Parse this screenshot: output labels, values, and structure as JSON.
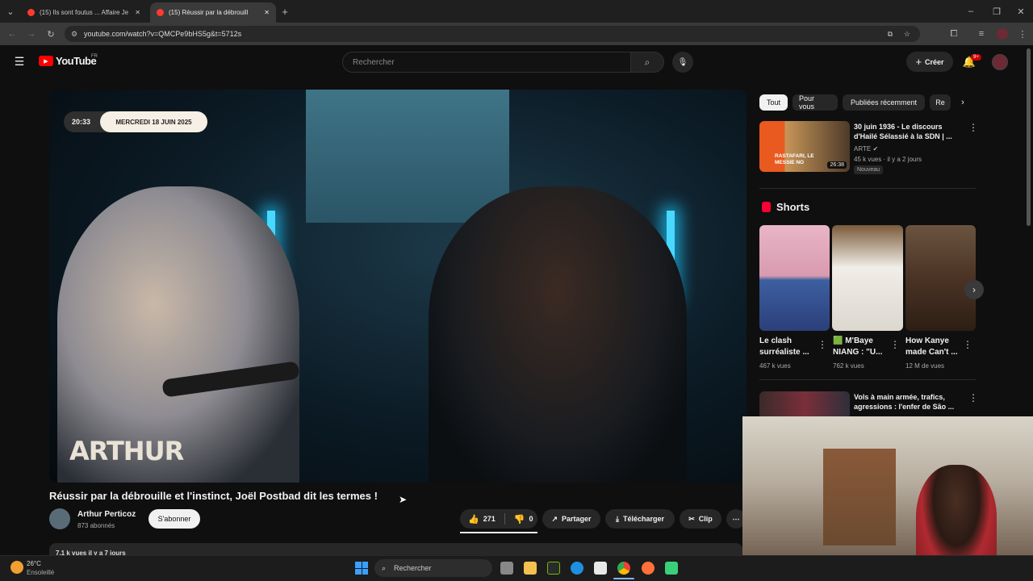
{
  "browser": {
    "tabs": [
      {
        "title": "(15) Ils sont foutus ... Affaire Je"
      },
      {
        "title": "(15) Réussir par la débrouill"
      }
    ],
    "url": "youtube.com/watch?v=QMCPe9bHS5g&t=5712s"
  },
  "header": {
    "logo_text": "YouTube",
    "region": "FR",
    "search_placeholder": "Rechercher",
    "create_label": "Créer",
    "notif_badge": "9+"
  },
  "video": {
    "time_chip": "20:33",
    "date_chip": "MERCREDI 18 JUIN 2025",
    "overlay_text": "ARTHUR",
    "title": "Réussir par la débrouille et l'instinct, Joël Postbad dit les termes !",
    "channel": "Arthur Perticoz",
    "subscribers": "873 abonnés",
    "subscribe_label": "S'abonner",
    "likes": "271",
    "dislikes": "0",
    "share_label": "Partager",
    "download_label": "Télécharger",
    "clip_label": "Clip",
    "views_partial": "7,1 k vues  il y a 7 jours"
  },
  "sidebar": {
    "chips": [
      "Tout",
      "Pour vous",
      "Publiées récemment",
      "Re"
    ],
    "rec1": {
      "title": "30 juin 1936 - Le discours d'Hailé Sélassié à la SDN | ...",
      "channel": "ARTE",
      "meta": "45 k vues · il y a 2 jours",
      "badge": "Nouveau",
      "duration": "26:38",
      "thumb_text": "RASTAFARI, LE MESSIE NO"
    },
    "shorts_heading": "Shorts",
    "shorts": [
      {
        "title1": "Le clash",
        "title2": "surréaliste ...",
        "views": "467 k vues"
      },
      {
        "title1": "🟩 M'Baye",
        "title2": "NIANG : \"U...",
        "views": "762 k vues"
      },
      {
        "title1": "How Kanye",
        "title2": "made Can't ...",
        "views": "12 M de vues"
      }
    ],
    "rec2": {
      "title": "Vols à main armée, trafics, agressions : l'enfer de São ..."
    }
  },
  "taskbar": {
    "weather_temp": "26°C",
    "weather_text": "Ensoleillé",
    "search_placeholder": "Rechercher"
  }
}
